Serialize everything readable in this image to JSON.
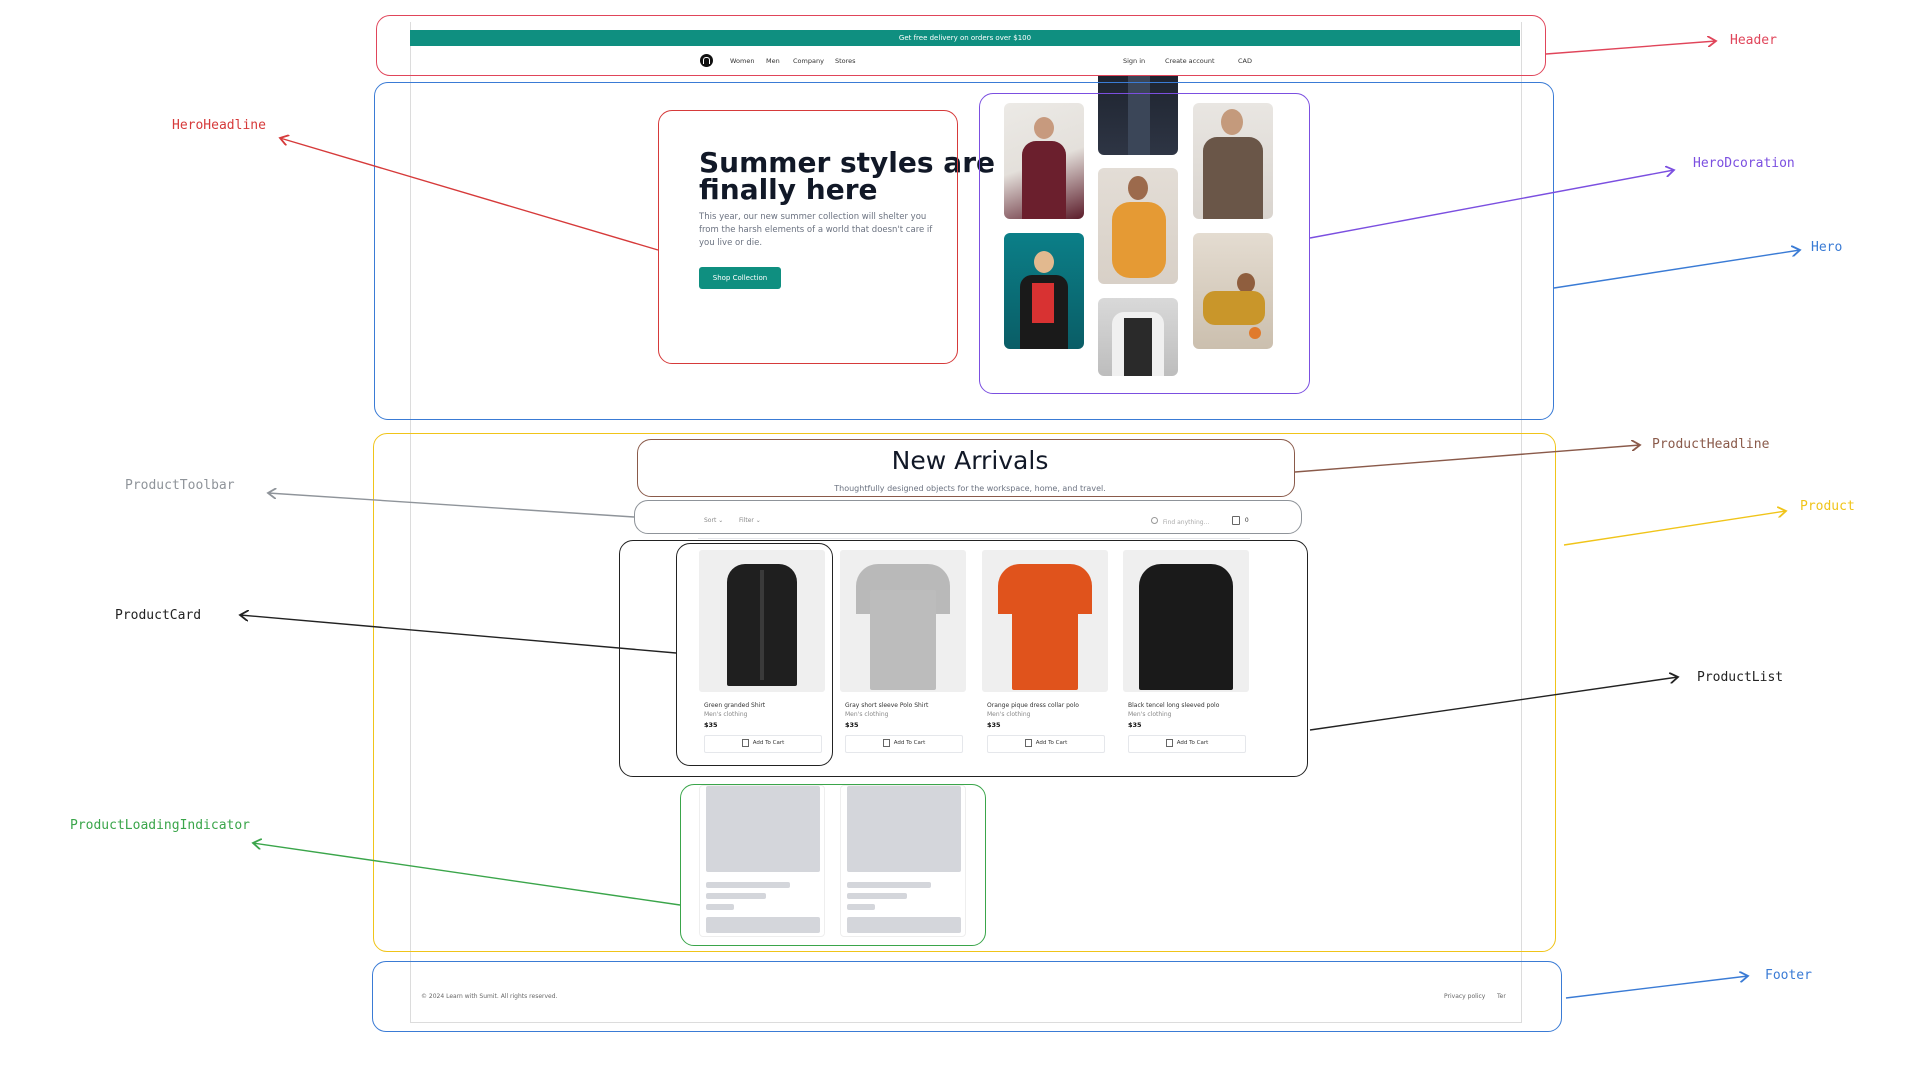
{
  "site": {
    "banner": "Get free delivery on orders over $100",
    "nav": [
      "Women",
      "Men",
      "Company",
      "Stores"
    ],
    "account_links": [
      "Sign in",
      "Create account"
    ],
    "currency": "CAD",
    "hero": {
      "title_line1": "Summer styles are",
      "title_line2": "finally here",
      "text_line1": "This year, our new summer collection will shelter you",
      "text_line2": "from the harsh elements of a world that doesn't care if",
      "text_line3": "you live or die.",
      "cta": "Shop Collection"
    },
    "products_section": {
      "title": "New Arrivals",
      "subtitle": "Thoughtfully designed objects for the workspace, home, and travel.",
      "sort": "Sort",
      "filter": "Filter",
      "search_placeholder": "Find anything...",
      "cart_count": "0"
    },
    "products": [
      {
        "name": "Green granded Shirt",
        "category": "Men's clothing",
        "price": "$35",
        "button": "Add To Cart",
        "color": "#1f1f1f"
      },
      {
        "name": "Gray short sleeve Polo Shirt",
        "category": "Men's clothing",
        "price": "$35",
        "button": "Add To Cart",
        "color": "#b9b9b9"
      },
      {
        "name": "Orange pique dress collar polo",
        "category": "Men's clothing",
        "price": "$35",
        "button": "Add To Cart",
        "color": "#e0531c"
      },
      {
        "name": "Black tencel long sleeved polo",
        "category": "Men's clothing",
        "price": "$35",
        "button": "Add To Cart",
        "color": "#1a1a1a"
      }
    ],
    "footer": {
      "copyright": "© 2024 Learn with Sumit. All rights reserved.",
      "links": [
        "Privacy policy",
        "Ter"
      ]
    }
  },
  "annotations": [
    {
      "label": "Header",
      "color": "#e0455a"
    },
    {
      "label": "HeroHeadline",
      "color": "#d63a3a"
    },
    {
      "label": "HeroDcoration",
      "color": "#7b4fe0"
    },
    {
      "label": "Hero",
      "color": "#3a7bd5"
    },
    {
      "label": "ProductHeadline",
      "color": "#8a5a4a"
    },
    {
      "label": "ProductToolbar",
      "color": "#8f949a"
    },
    {
      "label": "Product",
      "color": "#f0c419"
    },
    {
      "label": "ProductCard",
      "color": "#222222"
    },
    {
      "label": "ProductList",
      "color": "#222222"
    },
    {
      "label": "ProductLoadingIndicator",
      "color": "#3aa54a"
    },
    {
      "label": "Footer",
      "color": "#3a7bd5"
    }
  ]
}
